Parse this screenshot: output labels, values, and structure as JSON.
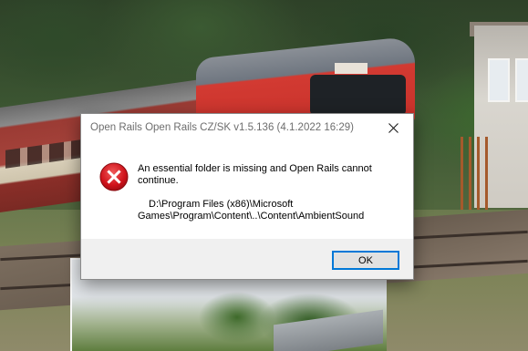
{
  "dialog": {
    "title": "Open Rails Open Rails CZ/SK v1.5.136 (4.1.2022 16:29)",
    "message": "An essential folder is missing and Open Rails cannot continue.",
    "path": "D:\\Program Files (x86)\\Microsoft Games\\Program\\Content\\..\\Content\\AmbientSound",
    "ok_label": "OK",
    "icon": "error-icon",
    "close_icon": "close-icon"
  },
  "background": {
    "loco_plate_icon": "locomotive-plate"
  },
  "colors": {
    "error_red": "#d0121b",
    "button_border": "#0078d7",
    "footer_bg": "#f0f0f0"
  }
}
